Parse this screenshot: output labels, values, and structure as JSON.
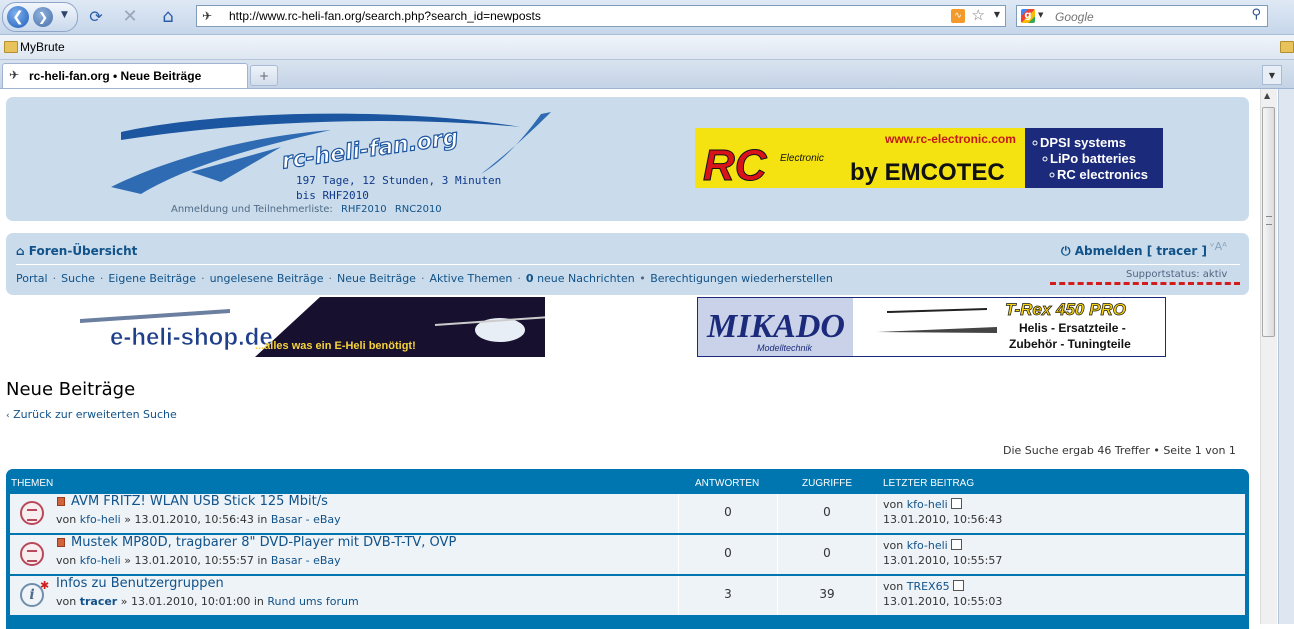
{
  "browser": {
    "url": "http://www.rc-heli-fan.org/search.php?search_id=newposts",
    "search_placeholder": "Google",
    "bookmark": "MyBrute",
    "tab_title": "rc-heli-fan.org • Neue Beiträge",
    "new_tab": "+"
  },
  "header": {
    "logo_text": "rc-heli-fan.org",
    "countdown_line1": "197 Tage, 12 Stunden, 3 Minuten",
    "countdown_line2": "bis RHF2010",
    "reg_label": "Anmeldung und Teilnehmerliste:",
    "reg_links": [
      "RHF2010",
      "RNC2010"
    ]
  },
  "ads": {
    "rc": {
      "url": "www.rc-electronic.com",
      "brand": "RC",
      "sub": "Electronic",
      "by": "by EMCOTEC",
      "bullets": [
        "DPSI systems",
        "LiPo batteries",
        "RC electronics"
      ]
    },
    "ehs": {
      "brand": "e-heli-shop.de",
      "tagline": "...alles was ein E-Heli benötigt!"
    },
    "mikado": {
      "brand": "MIKADO",
      "sub": "Modelltechnik",
      "model": "T-Rex 450 PRO",
      "line1": "Helis - Ersatzteile -",
      "line2": "Zubehör - Tuningteile"
    }
  },
  "nav": {
    "home": "Foren-Übersicht",
    "logout": "Abmelden [ tracer ]",
    "font_size": "ᵛAᴬ",
    "links": [
      "Portal",
      "Suche",
      "Eigene Beiträge",
      "ungelesene Beiträge",
      "Neue Beiträge",
      "Aktive Themen"
    ],
    "new_msgs_count": "0",
    "new_msgs_label": "neue Nachrichten",
    "restore": "Berechtigungen wiederherstellen",
    "support": "Supportstatus: aktiv"
  },
  "page": {
    "title": "Neue Beiträge",
    "back": "Zurück zur erweiterten Suche",
    "result": "Die Suche ergab 46 Treffer • Seite 1 von 1"
  },
  "table": {
    "headers": {
      "topics": "THEMEN",
      "replies": "ANTWORTEN",
      "views": "ZUGRIFFE",
      "last": "LETZTER BEITRAG"
    },
    "rows": [
      {
        "title": "AVM FRITZ! WLAN USB Stick 125 Mbit/s",
        "by": "von",
        "author": "kfo-heli",
        "date": "» 13.01.2010, 10:56:43 in",
        "forum": "Basar - eBay",
        "replies": "0",
        "views": "0",
        "last_by": "von",
        "last_author": "kfo-heli",
        "last_date": "13.01.2010, 10:56:43"
      },
      {
        "title": "Mustek MP80D, tragbarer 8\" DVD-Player mit DVB-T-TV, OVP",
        "by": "von",
        "author": "kfo-heli",
        "date": "» 13.01.2010, 10:55:57 in",
        "forum": "Basar - eBay",
        "replies": "0",
        "views": "0",
        "last_by": "von",
        "last_author": "kfo-heli",
        "last_date": "13.01.2010, 10:55:57"
      },
      {
        "title": "Infos zu Benutzergruppen",
        "by": "von",
        "author": "tracer",
        "date": "» 13.01.2010, 10:01:00 in",
        "forum": "Rund ums forum",
        "replies": "3",
        "views": "39",
        "last_by": "von",
        "last_author": "TREX65",
        "last_date": "13.01.2010, 10:55:03"
      }
    ]
  }
}
